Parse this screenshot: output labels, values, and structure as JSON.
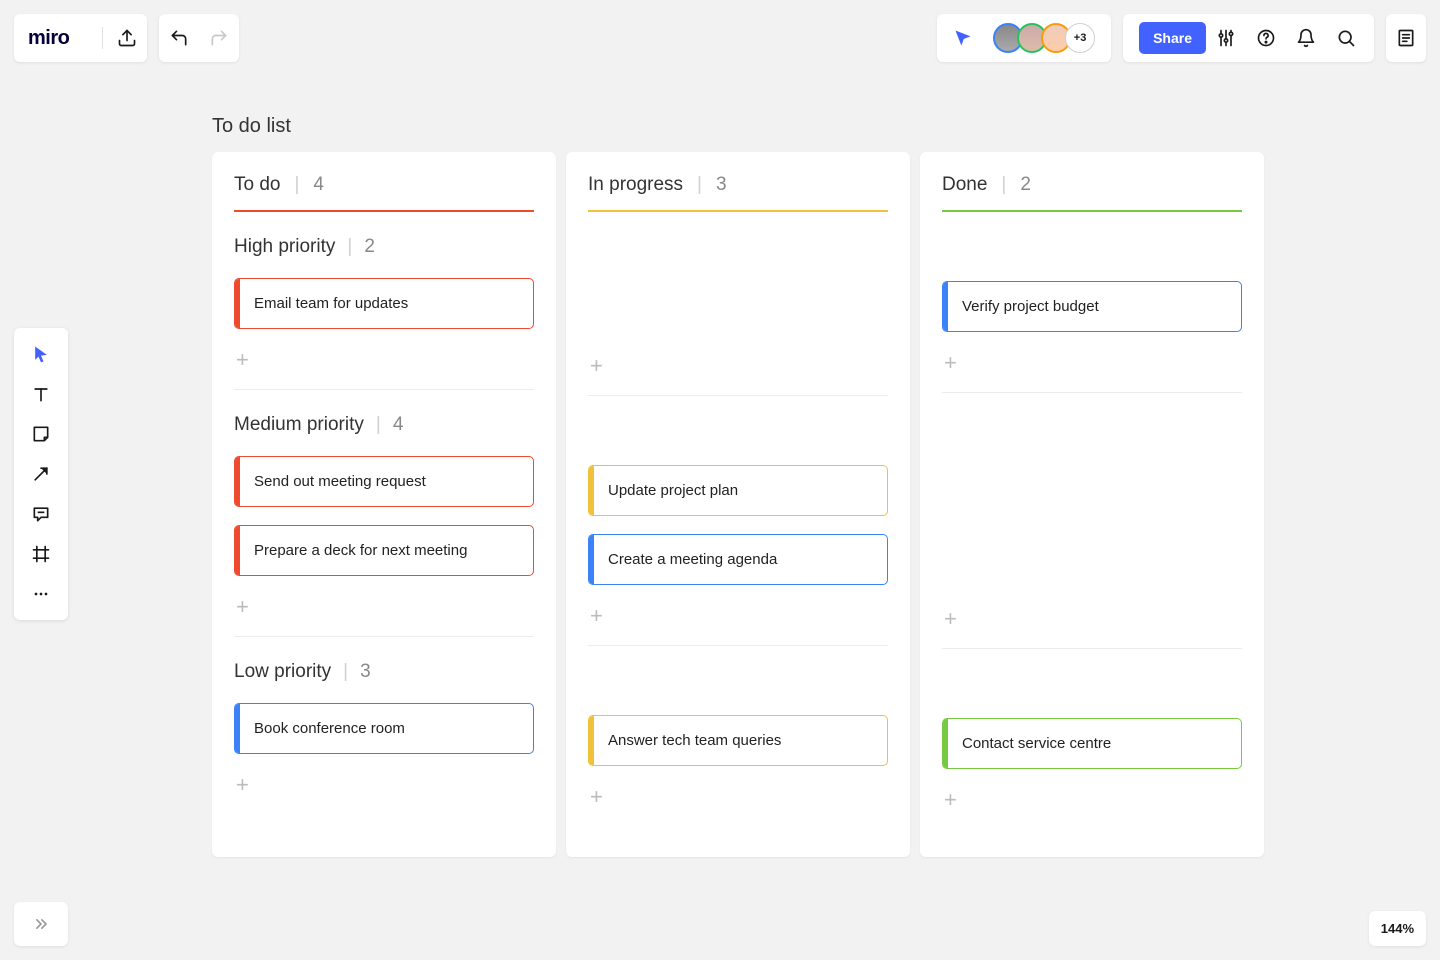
{
  "app": {
    "logo_text": "miro"
  },
  "toolbar": {
    "share_label": "Share",
    "more_avatars": "+3"
  },
  "zoom": {
    "label": "144%"
  },
  "board": {
    "title": "To do list",
    "columns": [
      {
        "label": "To do",
        "count": "4",
        "underline_color": "#ef4a2e",
        "sections": [
          {
            "label": "High priority",
            "count": "2",
            "cards": [
              {
                "text": "Email team for updates",
                "color": "#ef4a2e"
              }
            ]
          },
          {
            "label": "Medium priority",
            "count": "4",
            "cards": [
              {
                "text": "Send out meeting request",
                "color": "#ef4a2e"
              },
              {
                "text": "Prepare a deck for next meeting",
                "color": "#ef4a2e"
              }
            ]
          },
          {
            "label": "Low priority",
            "count": "3",
            "cards": [
              {
                "text": "Book conference room",
                "color": "#3b82f6"
              }
            ]
          }
        ]
      },
      {
        "label": "In progress",
        "count": "3",
        "underline_color": "#f0c23c",
        "sections": [
          {
            "label": "",
            "count": "",
            "cards": []
          },
          {
            "label": "",
            "count": "",
            "cards": [
              {
                "text": "Update project plan",
                "color": "#f0c23c"
              },
              {
                "text": "Create a meeting agenda",
                "color": "#3b82f6"
              }
            ]
          },
          {
            "label": "",
            "count": "",
            "cards": [
              {
                "text": "Answer tech team queries",
                "color": "#f0c23c"
              }
            ]
          }
        ]
      },
      {
        "label": "Done",
        "count": "2",
        "underline_color": "#77c940",
        "sections": [
          {
            "label": "",
            "count": "",
            "cards": [
              {
                "text": "Verify project budget",
                "color": "#3b82f6"
              }
            ]
          },
          {
            "label": "",
            "count": "",
            "cards": []
          },
          {
            "label": "",
            "count": "",
            "cards": [
              {
                "text": "Contact service centre",
                "color": "#77c940"
              }
            ]
          }
        ]
      }
    ]
  }
}
